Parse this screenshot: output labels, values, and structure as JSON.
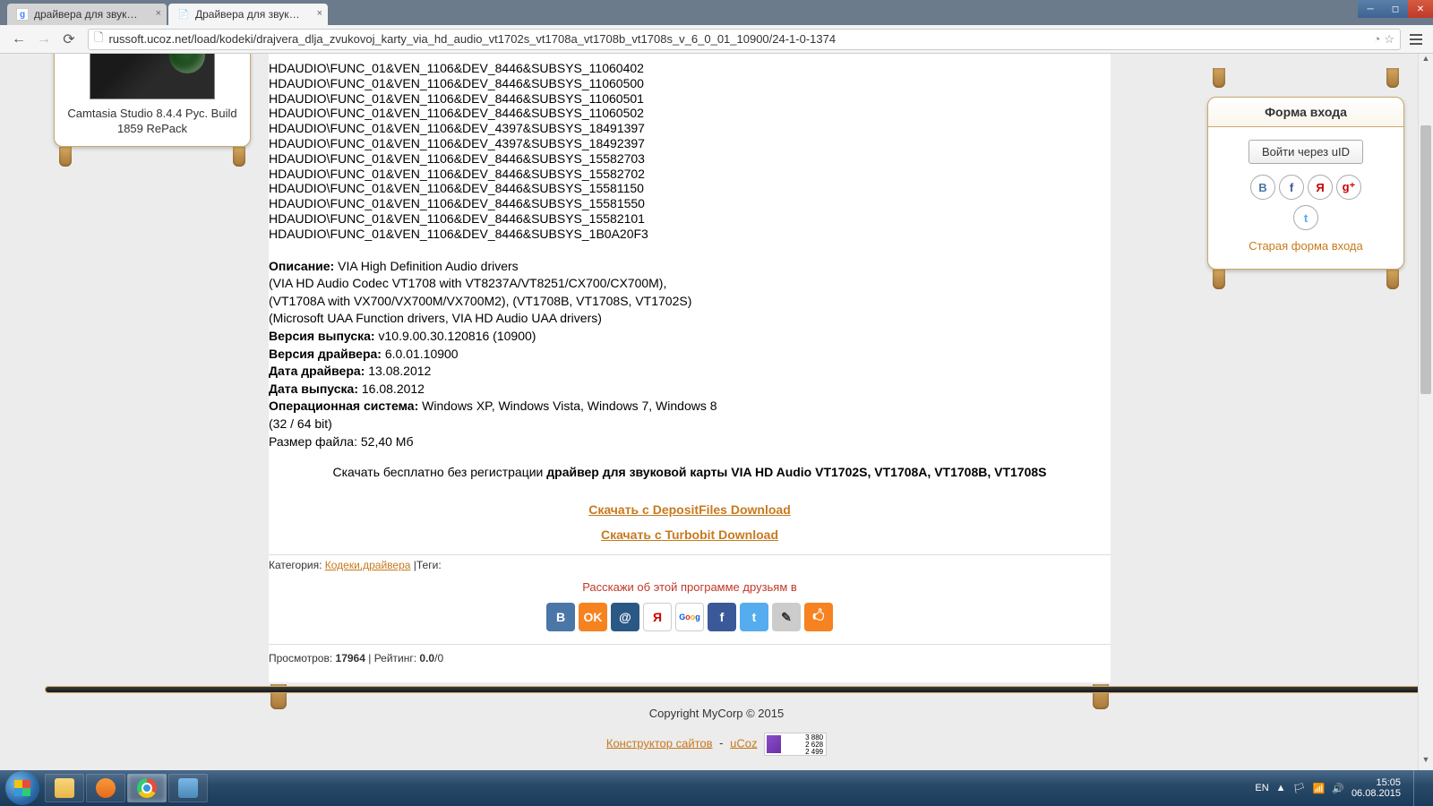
{
  "browser": {
    "tabs": [
      {
        "title": "драйвера для звуковой к",
        "favicon": "g"
      },
      {
        "title": "Драйвера для звуковой к",
        "favicon": "●"
      }
    ],
    "url": "russoft.ucoz.net/load/kodeki/drajvera_dlja_zvukovoj_karty_via_hd_audio_vt1702s_vt1708a_vt1708b_vt1708s_v_6_0_01_10900/24-1-0-1374"
  },
  "sidebar": {
    "product_name": "Camtasia Studio 8.4.4 Рус. Build 1859 RePack"
  },
  "hardware_ids": [
    "HDAUDIO\\FUNC_01&VEN_1106&DEV_8446&SUBSYS_11060402",
    "HDAUDIO\\FUNC_01&VEN_1106&DEV_8446&SUBSYS_11060500",
    "HDAUDIO\\FUNC_01&VEN_1106&DEV_8446&SUBSYS_11060501",
    "HDAUDIO\\FUNC_01&VEN_1106&DEV_8446&SUBSYS_11060502",
    "HDAUDIO\\FUNC_01&VEN_1106&DEV_4397&SUBSYS_18491397",
    "HDAUDIO\\FUNC_01&VEN_1106&DEV_4397&SUBSYS_18492397",
    "HDAUDIO\\FUNC_01&VEN_1106&DEV_8446&SUBSYS_15582703",
    "HDAUDIO\\FUNC_01&VEN_1106&DEV_8446&SUBSYS_15582702",
    "HDAUDIO\\FUNC_01&VEN_1106&DEV_8446&SUBSYS_15581150",
    "HDAUDIO\\FUNC_01&VEN_1106&DEV_8446&SUBSYS_15581550",
    "HDAUDIO\\FUNC_01&VEN_1106&DEV_8446&SUBSYS_15582101",
    "HDAUDIO\\FUNC_01&VEN_1106&DEV_8446&SUBSYS_1B0A20F3"
  ],
  "desc": {
    "label_desc": "Описание:",
    "desc_text": " VIA High Definition Audio drivers",
    "line2": "(VIA HD Audio Codec VT1708 with VT8237A/VT8251/CX700/CX700M),",
    "line3": "(VT1708A with VX700/VX700M/VX700M2), (VT1708B, VT1708S, VT1702S)",
    "line4": "(Microsoft UAA Function drivers, VIA HD Audio UAA drivers)",
    "label_release": "Версия выпуска:",
    "release": " v10.9.00.30.120816 (10900)",
    "label_driver_ver": "Версия драйвера:",
    "driver_ver": " 6.0.01.10900",
    "label_driver_date": "Дата драйвера:",
    "driver_date": " 13.08.2012",
    "label_release_date": "Дата выпуска:",
    "release_date": " 16.08.2012",
    "label_os": "Операционная система:",
    "os": " Windows XP, Windows Vista, Windows 7, Windows 8",
    "bits": "(32 / 64 bit)",
    "filesize": "Размер файла: 52,40 Мб"
  },
  "download": {
    "prefix": "Скачать бесплатно без регистрации ",
    "bold": "драйвер для звуковой карты VIA HD Audio VT1702S, VT1708A, VT1708B, VT1708S",
    "link1": "Скачать с DepositFiles Download",
    "link2": "Скачать с Turbobit Download"
  },
  "meta": {
    "category_label": "Категория: ",
    "category_link": "Кодеки,драйвера",
    "tags_label": " |Теги:"
  },
  "share": {
    "text": "Расскажи об этой программе друзьям в"
  },
  "stats": {
    "views_label": "Просмотров: ",
    "views": "17964",
    "sep": " | Рейтинг: ",
    "rating": "0.0",
    "rating_of": "/0"
  },
  "login": {
    "title": "Форма входа",
    "uid_button": "Войти через uID",
    "old_form": "Старая форма входа"
  },
  "footer": {
    "copyright": "Copyright MyCorp © 2015",
    "link1": "Конструктор сайтов",
    "dash": "-",
    "link2": "uCoz",
    "counter": {
      "n1": "3 880",
      "n2": "2 628",
      "n3": "2 499"
    }
  },
  "taskbar": {
    "lang": "EN",
    "time": "15:05",
    "date": "06.08.2015"
  }
}
